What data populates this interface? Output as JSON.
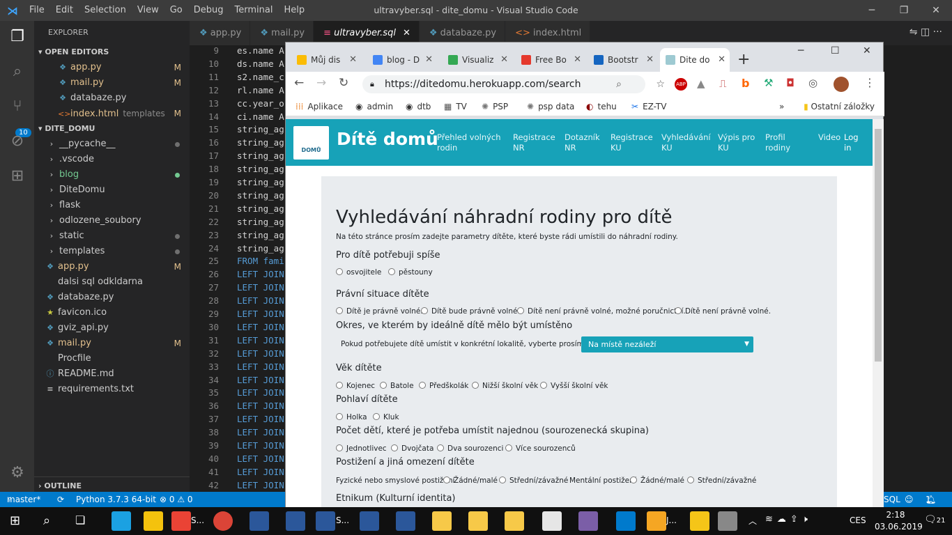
{
  "vscode": {
    "menu": [
      "File",
      "Edit",
      "Selection",
      "View",
      "Go",
      "Debug",
      "Terminal",
      "Help"
    ],
    "window_title": "ultravyber.sql - dite_domu - Visual Studio Code",
    "activity_badge": "10",
    "explorer_title": "EXPLORER",
    "open_editors_label": "OPEN EDITORS",
    "open_editors": [
      {
        "name": "app.py",
        "status": "M"
      },
      {
        "name": "mail.py",
        "status": "M"
      },
      {
        "name": "ultravyber.sql",
        "status": ""
      },
      {
        "name": "databaze.py",
        "status": ""
      },
      {
        "name": "index.html",
        "hint": "templates",
        "status": "M"
      }
    ],
    "project_label": "DITE_DOMU",
    "tree": [
      {
        "name": "__pycache__"
      },
      {
        "name": ".vscode"
      },
      {
        "name": "blog"
      },
      {
        "name": "DiteDomu"
      },
      {
        "name": "flask"
      },
      {
        "name": "odlozene_soubory"
      },
      {
        "name": "static"
      },
      {
        "name": "templates"
      },
      {
        "name": "app.py",
        "status": "M"
      },
      {
        "name": "dalsi sql odkldarna"
      },
      {
        "name": "databaze.py"
      },
      {
        "name": "favicon.ico"
      },
      {
        "name": "gviz_api.py"
      },
      {
        "name": "mail.py",
        "status": "M"
      },
      {
        "name": "Procfile"
      },
      {
        "name": "README.md"
      },
      {
        "name": "requirements.txt"
      },
      {
        "name": "ultravyber.sql"
      }
    ],
    "outline_label": "OUTLINE",
    "tabs": [
      "app.py",
      "mail.py",
      "ultravyber.sql",
      "databaze.py",
      "index.html"
    ],
    "line_numbers": [
      "9",
      "10",
      "11",
      "12",
      "13",
      "14",
      "15",
      "16",
      "17",
      "18",
      "19",
      "20",
      "21",
      "22",
      "23",
      "24",
      "25",
      "26",
      "27",
      "28",
      "29",
      "30",
      "31",
      "32",
      "33",
      "34",
      "35",
      "36",
      "37",
      "38",
      "39",
      "40",
      "41",
      "42"
    ],
    "code_lines": [
      "es.name A",
      "ds.name A",
      "s2.name_c",
      "rl.name A",
      "cc.year_o",
      "ci.name A",
      "string_ag",
      "string_ag",
      "string_ag",
      "string_ag",
      "string_ag",
      "string_ag",
      "string_ag",
      "string_ag",
      "string_ag",
      "string_ag",
      "FROM fami",
      "LEFT JOIN",
      "LEFT JOIN",
      "LEFT JOIN",
      "LEFT JOIN",
      "LEFT JOIN",
      "LEFT JOIN",
      "LEFT JOIN",
      "LEFT JOIN",
      "LEFT JOIN",
      "LEFT JOIN",
      "LEFT JOIN",
      "LEFT JOIN",
      "LEFT JOIN",
      "LEFT JOIN",
      "LEFT JOIN",
      "LEFT JOIN",
      "LEFT JOIN"
    ],
    "status": {
      "branch": "master*",
      "python": "Python 3.7.3 64-bit",
      "problems": "⊗ 0 ⚠ 0",
      "lang": "SQL",
      "bell": "1"
    }
  },
  "chrome": {
    "tabs": [
      "Můj dis",
      "blog - D",
      "Visualiz",
      "Free Bo",
      "Bootstr",
      "Dite do"
    ],
    "url": "https://ditedomu.herokuapp.com/search",
    "bookmarks": [
      "Aplikace",
      "admin",
      "dtb",
      "TV",
      "PSP",
      "psp data",
      "tehu",
      "EZ-TV"
    ],
    "other_bookmarks": "Ostatní záložky"
  },
  "site": {
    "brand": "Dítě domů",
    "logo_text": "DOMŮ",
    "nav": [
      {
        "l1": "Přehled volných",
        "l2": "rodin"
      },
      {
        "l1": "Registrace",
        "l2": "NR"
      },
      {
        "l1": "Dotazník",
        "l2": "NR"
      },
      {
        "l1": "Registrace",
        "l2": "KU"
      },
      {
        "l1": "Vyhledávání",
        "l2": "KU"
      },
      {
        "l1": "Výpis pro",
        "l2": "KU"
      },
      {
        "l1": "Profil",
        "l2": "rodiny"
      },
      {
        "l1": "Video",
        "l2": ""
      },
      {
        "l1": "Log",
        "l2": "in"
      }
    ],
    "heading": "Vyhledávání náhradní rodiny pro dítě",
    "lead": "Na této stránce prosím zadejte parametry dítěte, které byste rádi umístili do náhradní rodiny.",
    "q1": "Pro dítě potřebuji spíše",
    "q1_opts": [
      "osvojitele",
      "pěstouny"
    ],
    "q2": "Právní situace dítěte",
    "q2_opts": [
      "Dítě je právně volné.",
      "Dítě bude právně volné.",
      "Dítě není právně volné, možné poručnictví.",
      "Dítě není právně volné."
    ],
    "q3": "Okres, ve kterém by ideálně dítě mělo být umístěno",
    "q3_text": "Pokud potřebujete dítě umístit v konkrétní lokalitě, vyberte prosím okres:",
    "q3_select": "Na místě nezáleží",
    "q4": "Věk dítěte",
    "q4_opts": [
      "Kojenec",
      "Batole",
      "Předškolák",
      "Nižší školní věk",
      "Vyšší školní věk"
    ],
    "q5": "Pohlaví dítěte",
    "q5_opts": [
      "Holka",
      "Kluk"
    ],
    "q6": "Počet dětí, které je potřeba umístit najednou (sourozenecká skupina)",
    "q6_opts": [
      "Jednotlivec",
      "Dvojčata",
      "Dva sourozenci",
      "Více sourozenců"
    ],
    "q7": "Postižení a jiná omezení dítěte",
    "q7_lab1": "Fyzické nebo smyslové postižení",
    "q7_lab2": "Mentální postižení",
    "q7_opts": [
      "Žádné/malé",
      "Střední/závažné"
    ],
    "q8": "Etnikum (Kulturní identita)"
  },
  "taskbar": {
    "time": "2:18",
    "date": "03.06.2019",
    "lang": "CES",
    "notif": "21",
    "chrome_label": "S...",
    "java_label": "J...",
    "word_label": "S..."
  }
}
